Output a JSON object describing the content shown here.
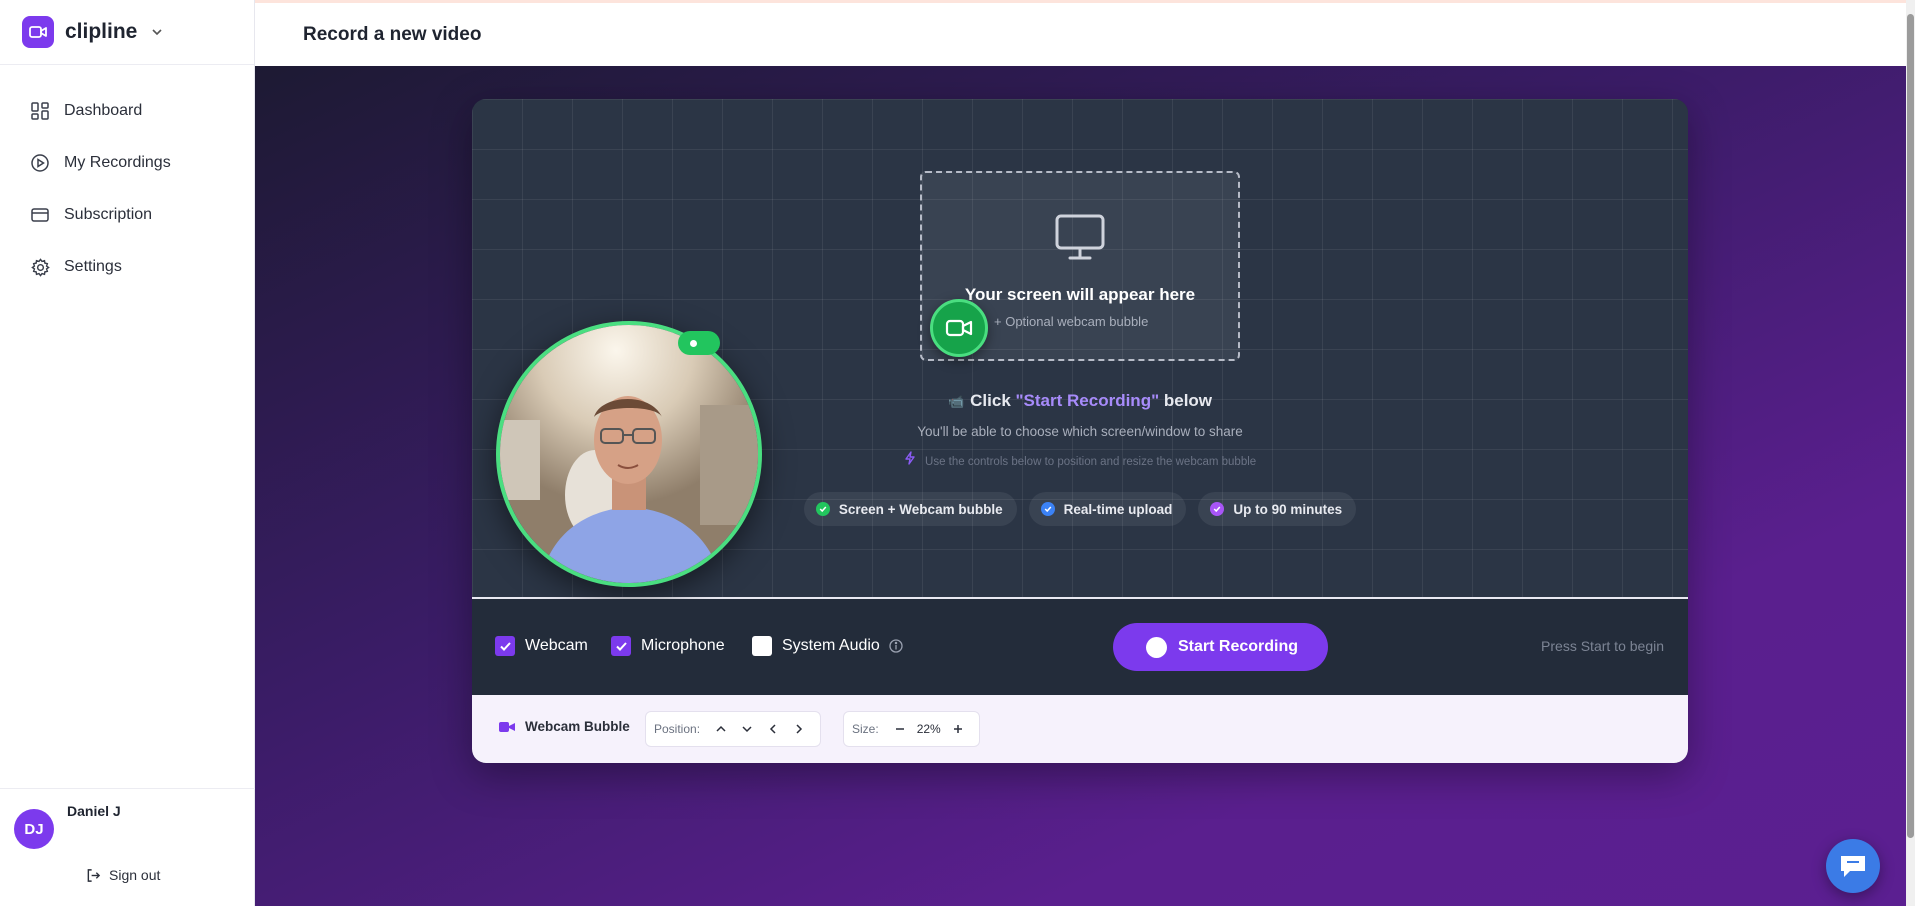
{
  "app": {
    "name": "clipline"
  },
  "sidebar": {
    "items": [
      {
        "label": "Dashboard",
        "icon": "dashboard-icon"
      },
      {
        "label": "My Recordings",
        "icon": "play-circle-icon"
      },
      {
        "label": "Subscription",
        "icon": "credit-card-icon"
      },
      {
        "label": "Settings",
        "icon": "gear-icon"
      }
    ],
    "user": {
      "initials": "DJ",
      "name": "Daniel J"
    },
    "signout_label": "Sign out"
  },
  "header": {
    "title": "Record a new video"
  },
  "stage": {
    "dropzone_title": "Your screen will appear here",
    "dropzone_sub": "+ Optional webcam bubble",
    "click_prefix": "Click ",
    "click_highlight": "\"Start Recording\"",
    "click_suffix": " below",
    "choose_text": "You'll be able to choose which screen/window to share",
    "hint_text": "Use the controls below to position and resize the webcam bubble",
    "features": [
      {
        "label": "Screen + Webcam bubble",
        "color": "#22c55e"
      },
      {
        "label": "Real-time upload",
        "color": "#3b82f6"
      },
      {
        "label": "Up to 90 minutes",
        "color": "#a855f7"
      }
    ]
  },
  "controls": {
    "webcam_label": "Webcam",
    "webcam_checked": true,
    "microphone_label": "Microphone",
    "microphone_checked": true,
    "system_audio_label": "System Audio",
    "system_audio_checked": false,
    "start_label": "Start Recording",
    "status_text": "Press Start to begin"
  },
  "bubble": {
    "title": "Webcam Bubble",
    "position_label": "Position:",
    "size_label": "Size:",
    "size_value": "22%"
  },
  "colors": {
    "accent": "#7c3aed",
    "live": "#22c55e"
  }
}
